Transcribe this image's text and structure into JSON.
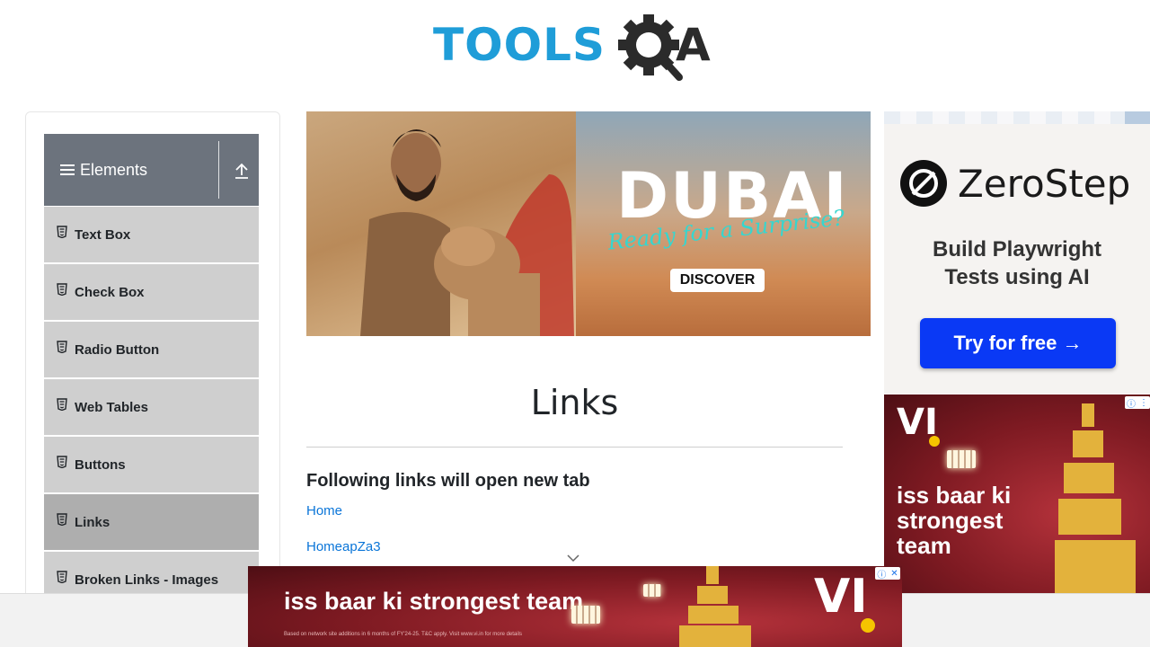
{
  "logo": {
    "text_tools": "TOOLS",
    "text_a": "A"
  },
  "sidebar": {
    "group_title": "Elements",
    "items": [
      {
        "label": "Text Box",
        "active": false
      },
      {
        "label": "Check Box",
        "active": false
      },
      {
        "label": "Radio Button",
        "active": false
      },
      {
        "label": "Web Tables",
        "active": false
      },
      {
        "label": "Buttons",
        "active": false
      },
      {
        "label": "Links",
        "active": true
      },
      {
        "label": "Broken Links - Images",
        "active": false
      }
    ]
  },
  "ad_dubai": {
    "title": "DUBAI",
    "tagline": "Ready for a Surprise?",
    "button": "DISCOVER"
  },
  "main": {
    "title": "Links",
    "section_heading": "Following links will open new tab",
    "links": [
      "Home",
      "HomeapZa3"
    ]
  },
  "ad_zerostep": {
    "brand": "ZeroStep",
    "subtitle_line1": "Build Playwright",
    "subtitle_line2": "Tests using AI",
    "button": "Try for free →"
  },
  "ad_vi": {
    "logo": "VI",
    "tagline_line1": "iss baar ki",
    "tagline_line2": "strongest",
    "tagline_line3": "team",
    "bottom_tagline": "iss baar ki strongest team",
    "fine_print": "Based on network site additions in 6 months of FY'24-25. T&C apply. Visit www.vi.in for more details",
    "adchoice_i": "ⓘ",
    "adchoice_close": "✕"
  },
  "colors": {
    "sidebar_header": "#6c737d",
    "menu_item": "#cfcfcf",
    "menu_item_active": "#aeaeae",
    "link": "#0a75d8",
    "logo_blue": "#1f9dd8",
    "zerostep_button": "#0a39f5"
  }
}
